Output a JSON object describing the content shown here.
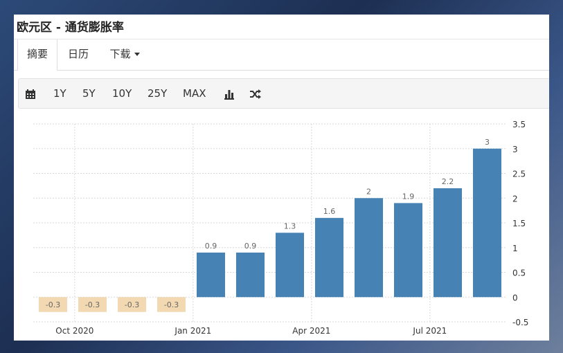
{
  "title": "欧元区 - 通货膨胀率",
  "tabs": [
    {
      "label": "摘要"
    },
    {
      "label": "日历"
    },
    {
      "label": "下载"
    }
  ],
  "toolbar": {
    "items": [
      "1Y",
      "5Y",
      "10Y",
      "25Y",
      "MAX"
    ],
    "icons": [
      "calendar-icon",
      "bar-chart-icon",
      "shuffle-icon"
    ]
  },
  "colors": {
    "positive_bar": "#4682b4",
    "negative_bar": "#f3d9b1",
    "grid": "#d9d9d9"
  },
  "chart_data": {
    "type": "bar",
    "categories": [
      "2020-09",
      "2020-10",
      "2020-11",
      "2020-12",
      "2021-01",
      "2021-02",
      "2021-03",
      "2021-04",
      "2021-05",
      "2021-06",
      "2021-07",
      "2021-08"
    ],
    "values": [
      -0.3,
      -0.3,
      -0.3,
      -0.3,
      0.9,
      0.9,
      1.3,
      1.6,
      2,
      1.9,
      2.2,
      3
    ],
    "value_labels": [
      "-0.3",
      "-0.3",
      "-0.3",
      "-0.3",
      "0.9",
      "0.9",
      "1.3",
      "1.6",
      "2",
      "1.9",
      "2.2",
      "3"
    ],
    "x_tick_labels": [
      {
        "label": "Oct 2020",
        "category": "2020-10"
      },
      {
        "label": "Jan 2021",
        "category": "2021-01"
      },
      {
        "label": "Apr 2021",
        "category": "2021-04"
      },
      {
        "label": "Jul 2021",
        "category": "2021-07"
      }
    ],
    "y_ticks": [
      "-0.5",
      "0",
      "0.5",
      "1",
      "1.5",
      "2",
      "2.5",
      "3",
      "3.5"
    ],
    "ylim": [
      -0.5,
      3.5
    ],
    "grid": true,
    "y_axis_side": "right",
    "title": "",
    "xlabel": "",
    "ylabel": ""
  }
}
